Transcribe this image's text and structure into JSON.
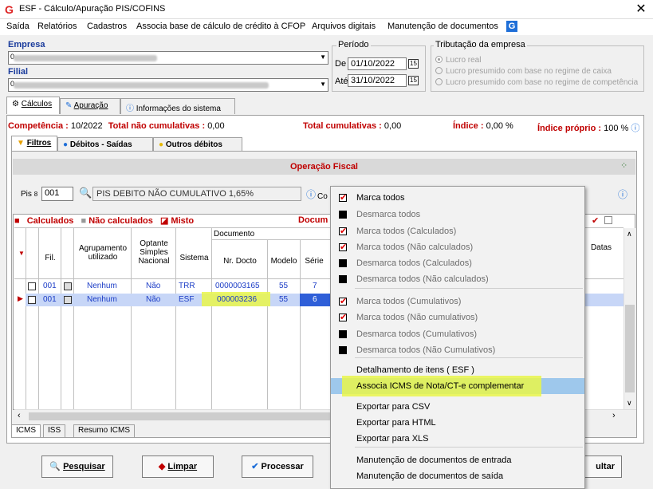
{
  "window": {
    "title": "ESF - Cálculo/Apuração PIS/COFINS",
    "close": "✕"
  },
  "menu": [
    "Saída",
    "Relatórios",
    "Cadastros",
    "Associa base de cálculo de crédito à CFOP",
    "Arquivos digitais",
    "Manutenção de documentos"
  ],
  "empresa": {
    "label": "Empresa",
    "value_hidden": "0"
  },
  "filial": {
    "label": "Filial",
    "value_hidden": "0"
  },
  "periodo": {
    "label": "Período",
    "de_label": "De",
    "de": "01/10/2022",
    "ate_label": "Até",
    "ate": "31/10/2022"
  },
  "tributacao": {
    "label": "Tributação da empresa",
    "options": [
      "Lucro real",
      "Lucro presumido com base no regime de caixa",
      "Lucro presumido com base no regime de competência"
    ],
    "selected": 0
  },
  "tabs_main": [
    "Cálculos",
    "Apuração",
    "Informações do sistema"
  ],
  "info": {
    "competencia_label": "Competência :",
    "competencia": "10/2022",
    "nao_cum_label": "Total não cumulativas :",
    "nao_cum": "0,00",
    "cum_label": "Total cumulativas :",
    "cum": "0,00",
    "indice_label": "Índice :",
    "indice": "0,00 %",
    "indice_proprio_label": "Índice próprio :",
    "indice_proprio": "100 %"
  },
  "tabs_sub": [
    "Filtros",
    "Débitos - Saídas",
    "Outros débitos"
  ],
  "operacao_fiscal": "Operação Fiscal",
  "pis": {
    "label": "Pis",
    "code": "001",
    "desc": "PIS DEBITO  NÃO CUMULATIVO 1,65%",
    "co_label": "Co"
  },
  "legend": {
    "calculados": "Calculados",
    "nao_calculados": "Não calculados",
    "misto": "Misto",
    "docum": "Docum"
  },
  "columns": {
    "fil": "Fil.",
    "agrup": "Agrupamento utilizado",
    "optante": "Optante Simples Nacional",
    "sistema": "Sistema",
    "documento": "Documento",
    "nr_docto": "Nr. Docto",
    "modelo": "Modelo",
    "serie": "Série",
    "datas": "Datas"
  },
  "rows": [
    {
      "fil": "001",
      "agrup": "Nenhum",
      "optante": "Não",
      "sistema": "TRR",
      "nr": "0000003165",
      "modelo": "55",
      "serie": "7"
    },
    {
      "fil": "001",
      "agrup": "Nenhum",
      "optante": "Não",
      "sistema": "ESF",
      "nr": "000003236",
      "modelo": "55",
      "serie": "6"
    }
  ],
  "bottom_tabs": [
    "ICMS",
    "ISS",
    "Resumo ICMS"
  ],
  "buttons": {
    "pesquisar": "Pesquisar",
    "limpar": "Limpar",
    "processar": "Processar",
    "consultar_tail": "ultar"
  },
  "context_menu": [
    {
      "label": "Marca todos",
      "icon": "check-red",
      "dim": false
    },
    {
      "label": "Desmarca todos",
      "icon": "black",
      "dim": true
    },
    {
      "label": "Marca todos (Calculados)",
      "icon": "check-red",
      "dim": true
    },
    {
      "label": "Marca todos (Não calculados)",
      "icon": "check-red",
      "dim": true
    },
    {
      "label": "Desmarca todos (Calculados)",
      "icon": "black",
      "dim": true
    },
    {
      "label": "Desmarca todos (Não calculados)",
      "icon": "black",
      "dim": true
    },
    {
      "label": "Marca todos (Cumulativos)",
      "icon": "check-red",
      "dim": true
    },
    {
      "label": "Marca todos (Não cumulativos)",
      "icon": "check-red",
      "dim": true
    },
    {
      "label": "Desmarca todos (Cumulativos)",
      "icon": "black",
      "dim": true
    },
    {
      "label": "Desmarca todos (Não Cumulativos)",
      "icon": "black",
      "dim": true
    },
    {
      "label": "Detalhamento de itens ( ESF )",
      "icon": "",
      "dim": false
    },
    {
      "label": "Associa ICMS de Nota/CT-e complementar",
      "icon": "",
      "dim": false
    },
    {
      "label": "Exportar para CSV",
      "icon": "",
      "dim": false
    },
    {
      "label": "Exportar para HTML",
      "icon": "",
      "dim": false
    },
    {
      "label": "Exportar para XLS",
      "icon": "",
      "dim": false
    },
    {
      "label": "Manutenção de documentos de entrada",
      "icon": "",
      "dim": false
    },
    {
      "label": "Manutenção de documentos de saída",
      "icon": "",
      "dim": false
    }
  ],
  "colors": {
    "accent_red": "#c00000",
    "selection": "#2f5fd8",
    "highlight": "#9ec8ec",
    "marker": "#e9f64a"
  }
}
